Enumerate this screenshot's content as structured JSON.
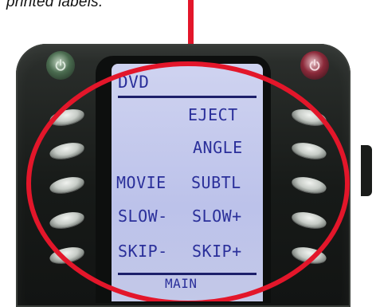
{
  "caption": {
    "text": "printed labels."
  },
  "lcd": {
    "title": "DVD",
    "left_labels": [
      "",
      "",
      "MOVIE",
      "SLOW-",
      "SKIP-"
    ],
    "right_labels": [
      "EJECT",
      "ANGLE",
      "SUBTL",
      "SLOW+",
      "SKIP+"
    ],
    "footer": "MAIN"
  },
  "icons": {
    "top_left": "power-icon",
    "top_right": "power-icon"
  },
  "colors": {
    "callout_red": "#e3162a",
    "lcd_background": "#c3c8e8",
    "lcd_text": "#2a2f9a",
    "device_body": "#1a1c1a"
  }
}
